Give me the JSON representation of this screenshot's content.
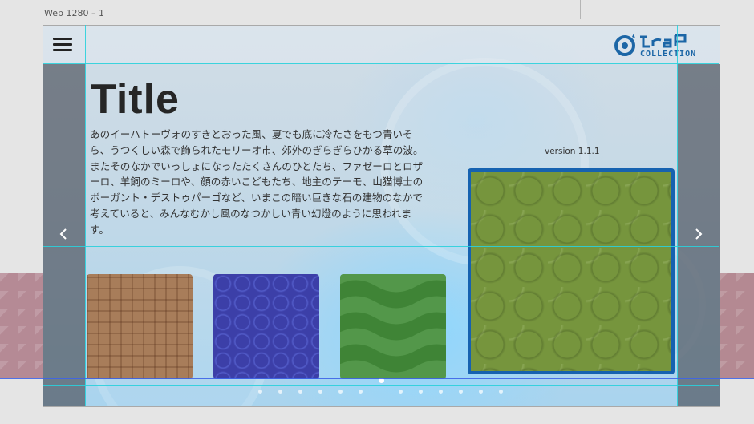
{
  "canvas": {
    "artboard_label": "Web 1280 – 1"
  },
  "header": {
    "menu_icon": "hamburger-icon",
    "logo_text": "COLLECTION",
    "logo_icon": "trap-logo-icon"
  },
  "hero": {
    "title": "Title",
    "body": "あのイーハトーヴォのすきとおった風、夏でも底に冷たさをもつ青いそら、うつくしい森で飾られたモリーオ市、郊外のぎらぎらひかる草の波。またそのなかでいっしょになったたくさんのひとたち、ファゼーロとロザーロ、羊飼のミーロや、顔の赤いこどもたち、地主のテーモ、山猫博士のボーガント・デストゥパーゴなど、いまこの暗い巨きな石の建物のなかで考えていると、みんなむかし風のなつかしい青い幻燈のように思われます。",
    "version": "version 1.1.1"
  },
  "navigation": {
    "prev_icon": "chevron-left-icon",
    "next_icon": "chevron-right-icon"
  },
  "carousel": {
    "tiles": [
      {
        "pattern": "plaid-brown",
        "color": "#a87d5a"
      },
      {
        "pattern": "floral-blue",
        "color": "#3c3fa8"
      },
      {
        "pattern": "waves-green",
        "color": "#53974a"
      },
      {
        "pattern": "circles-olive",
        "color": "#76953d",
        "selected": true
      }
    ],
    "page_count": 13,
    "active_page": 6
  },
  "colors": {
    "accent": "#1662b0",
    "guide": "#2ad0dc",
    "guide_blue": "#3e64e8"
  }
}
